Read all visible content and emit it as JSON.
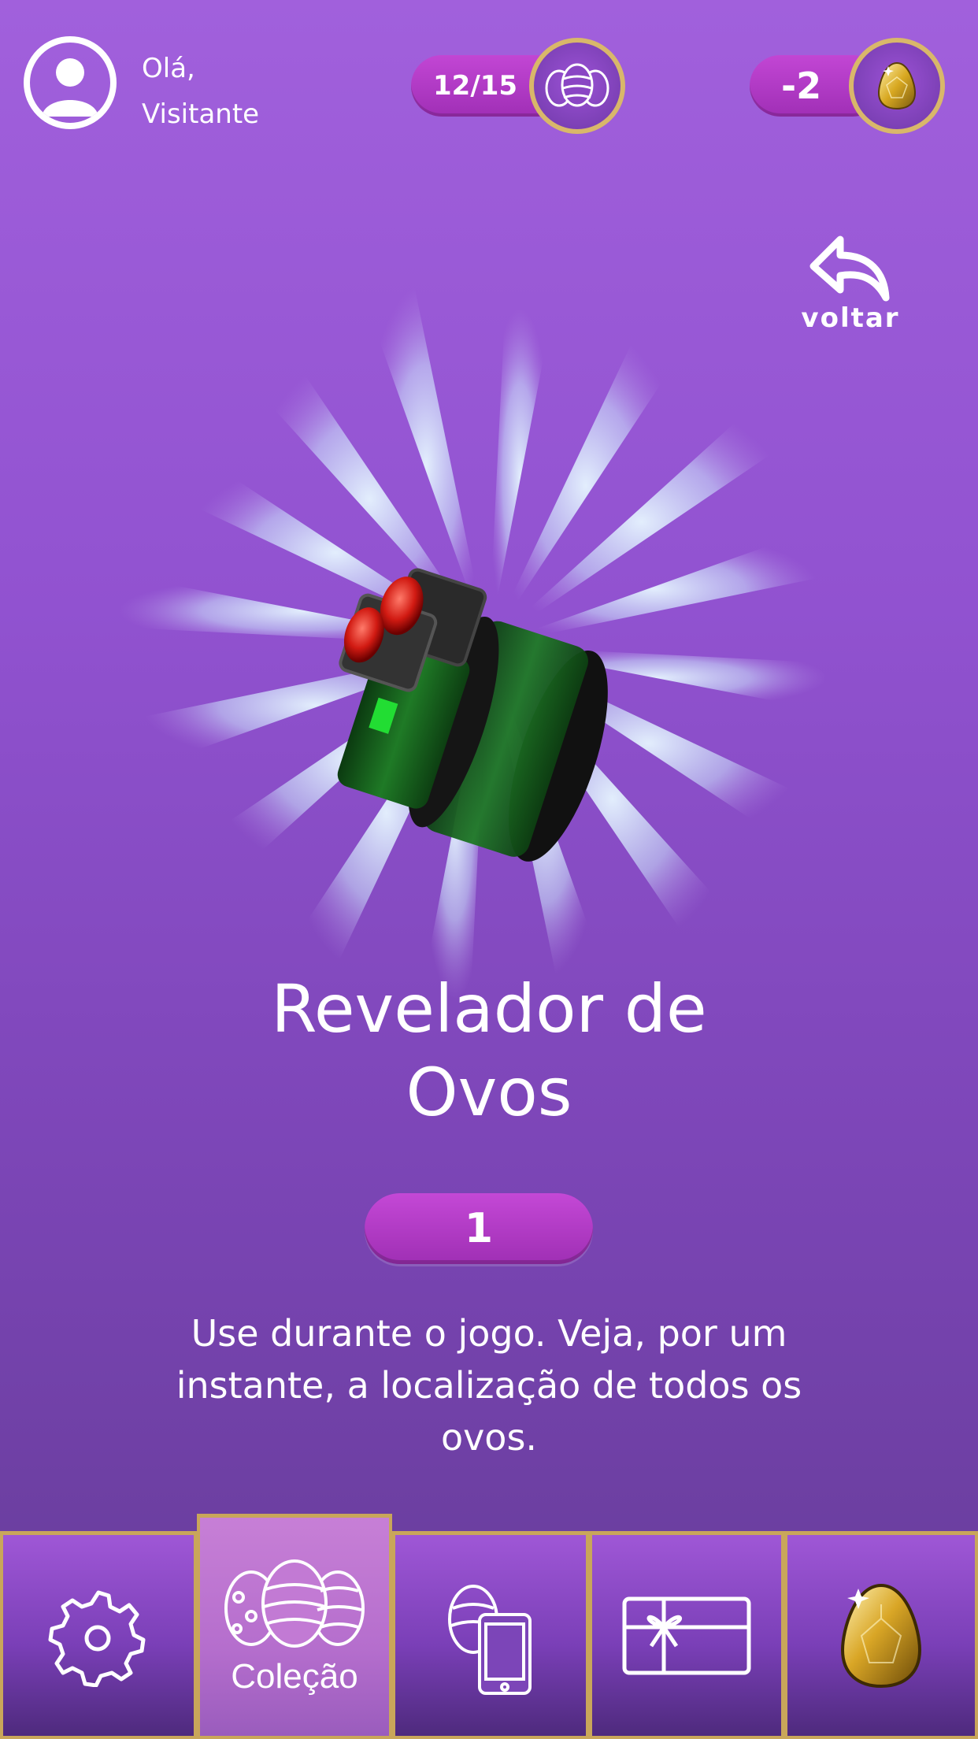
{
  "header": {
    "greeting_line1": "Olá,",
    "greeting_line2": "Visitante",
    "eggs_counter": "12/15",
    "coins_counter": "-2",
    "avatar_icon": "user-avatar-icon",
    "eggs_icon": "eggs-collection-icon",
    "coin_icon": "golden-egg-icon"
  },
  "back": {
    "label": "voltar",
    "icon": "back-arrow-icon"
  },
  "item": {
    "name_line1": "Revelador de",
    "name_line2": "Ovos",
    "quantity": "1",
    "description_line1": "Use durante o jogo. Veja, por um",
    "description_line2": "instante, a localização de todos os",
    "description_line3": "ovos.",
    "image_icon": "binoculars-icon"
  },
  "nav": {
    "tabs": [
      {
        "icon": "gear-icon",
        "label": ""
      },
      {
        "icon": "eggs-collection-icon",
        "label": "Coleção",
        "active": true
      },
      {
        "icon": "egg-phone-icon",
        "label": ""
      },
      {
        "icon": "gift-card-icon",
        "label": ""
      },
      {
        "icon": "golden-egg-icon",
        "label": ""
      }
    ]
  },
  "colors": {
    "background_top": "#a160dc",
    "background_bottom": "#633b95",
    "pill": "#b23cc6",
    "gold_border": "#c9a65a"
  }
}
